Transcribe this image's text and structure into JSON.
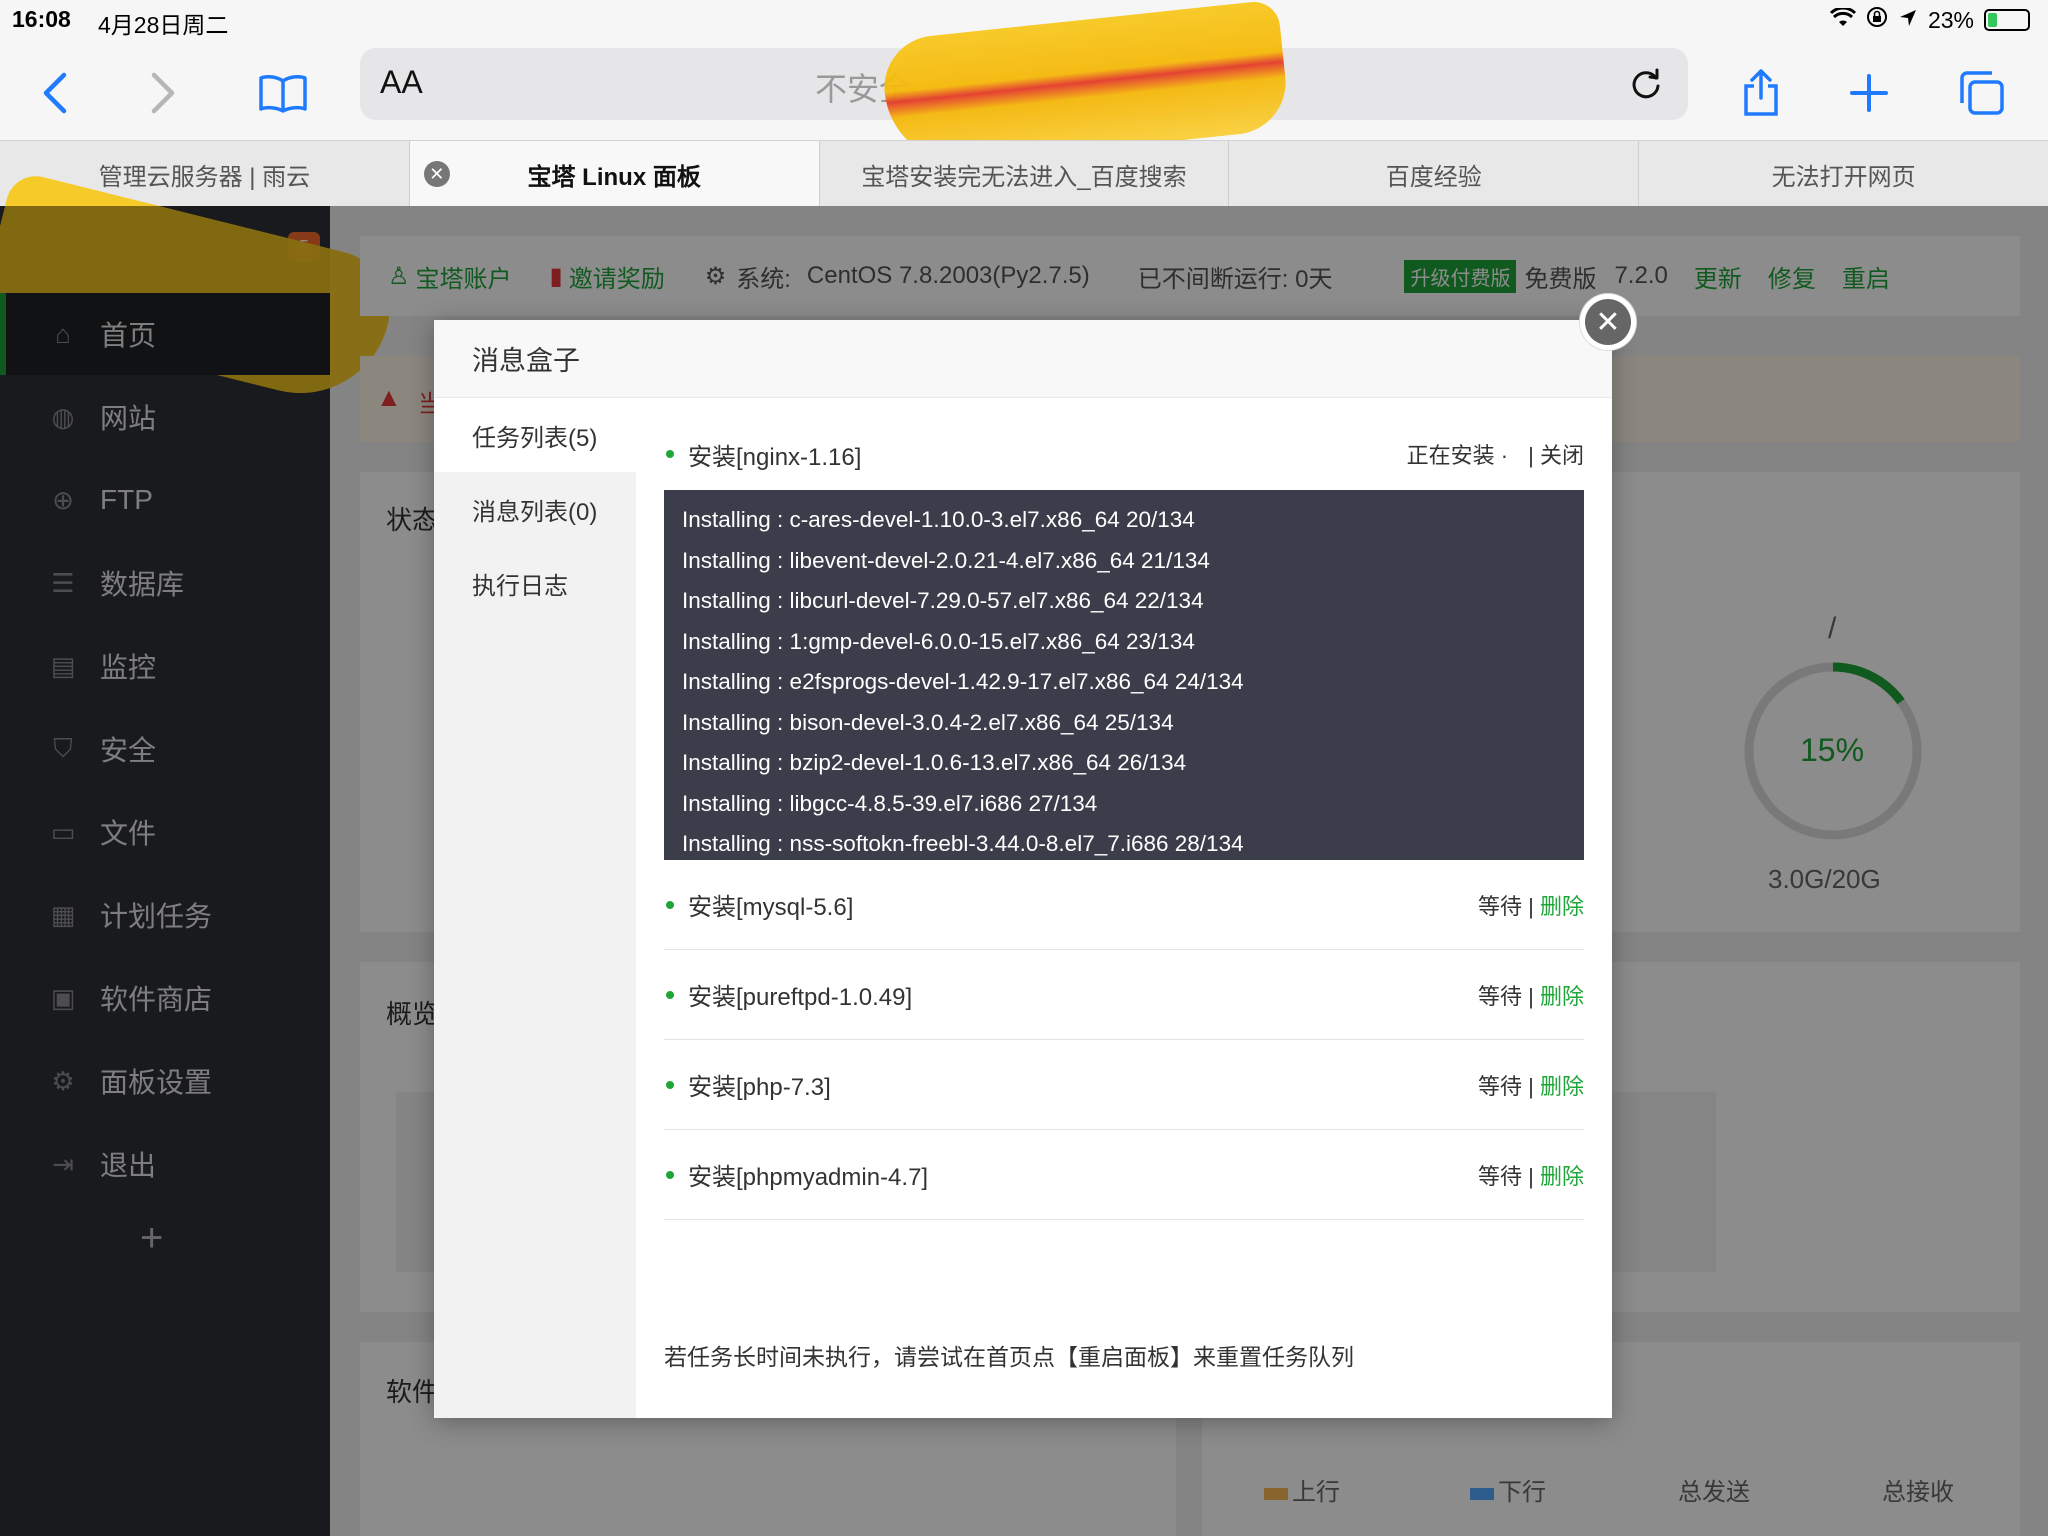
{
  "status_bar": {
    "time": "16:08",
    "date": "4月28日周二",
    "battery": "23%",
    "battery_level": 0.23
  },
  "toolbar": {
    "reader_label": "AA",
    "url_text": "不安全"
  },
  "tabs": [
    {
      "label": "管理云服务器 | 雨云",
      "active": false
    },
    {
      "label": "宝塔 Linux 面板",
      "active": true
    },
    {
      "label": "宝塔安装完无法进入_百度搜索",
      "active": false
    },
    {
      "label": "百度经验",
      "active": false
    },
    {
      "label": "无法打开网页",
      "active": false
    }
  ],
  "sidebar": {
    "badge": "5",
    "items": [
      {
        "label": "首页",
        "icon": "home-icon"
      },
      {
        "label": "网站",
        "icon": "globe-icon"
      },
      {
        "label": "FTP",
        "icon": "ftp-icon"
      },
      {
        "label": "数据库",
        "icon": "database-icon"
      },
      {
        "label": "监控",
        "icon": "monitor-icon"
      },
      {
        "label": "安全",
        "icon": "shield-icon"
      },
      {
        "label": "文件",
        "icon": "folder-icon"
      },
      {
        "label": "计划任务",
        "icon": "calendar-icon"
      },
      {
        "label": "软件商店",
        "icon": "apps-icon"
      },
      {
        "label": "面板设置",
        "icon": "gear-icon"
      },
      {
        "label": "退出",
        "icon": "logout-icon"
      }
    ],
    "plus": "+"
  },
  "topbar": {
    "account": "宝塔账户",
    "invite": "邀请奖励",
    "system_label": "系统:",
    "system_value": "CentOS 7.8.2003(Py2.7.5)",
    "uptime": "已不间断运行: 0天",
    "upgrade": "升级付费版",
    "edition": "免费版",
    "version": "7.2.0",
    "update": "更新",
    "repair": "修复",
    "restart": "重启"
  },
  "page": {
    "warning_fragment": "当",
    "status_title": "状态",
    "overview_title": "概览",
    "software_title": "软件",
    "disk": {
      "path": "/",
      "percent": "15%",
      "percent_value": 0.15,
      "usage": "3.0G/20G"
    },
    "traffic": {
      "up": "上行",
      "down": "下行",
      "sent": "总发送",
      "received": "总接收"
    }
  },
  "modal": {
    "title": "消息盒子",
    "nav": [
      "任务列表(5)",
      "消息列表(0)",
      "执行日志"
    ],
    "current_task": {
      "name": "安装[nginx-1.16]",
      "status": "正在安装 ·",
      "close": "| 关闭"
    },
    "log_lines": [
      "Installing : c-ares-devel-1.10.0-3.el7.x86_64 20/134",
      "Installing : libevent-devel-2.0.21-4.el7.x86_64 21/134",
      "Installing : libcurl-devel-7.29.0-57.el7.x86_64 22/134",
      "Installing : 1:gmp-devel-6.0.0-15.el7.x86_64 23/134",
      "Installing : e2fsprogs-devel-1.42.9-17.el7.x86_64 24/134",
      "Installing : bison-devel-3.0.4-2.el7.x86_64 25/134",
      "Installing : bzip2-devel-1.0.6-13.el7.x86_64 26/134",
      "Installing : libgcc-4.8.5-39.el7.i686 27/134",
      "Installing : nss-softokn-freebl-3.44.0-8.el7_7.i686 28/134"
    ],
    "queued_tasks": [
      {
        "name": "安装[mysql-5.6]",
        "status": "等待 |",
        "action": "删除"
      },
      {
        "name": "安装[pureftpd-1.0.49]",
        "status": "等待 |",
        "action": "删除"
      },
      {
        "name": "安装[php-7.3]",
        "status": "等待 |",
        "action": "删除"
      },
      {
        "name": "安装[phpmyadmin-4.7]",
        "status": "等待 |",
        "action": "删除"
      }
    ],
    "footnote": "若任务长时间未执行，请尝试在首页点【重启面板】来重置任务队列"
  },
  "colors": {
    "accent": "#20a53a",
    "safari_blue": "#1f7aff",
    "sidebar_bg": "#2d3036",
    "log_bg": "#3b3d4a"
  }
}
